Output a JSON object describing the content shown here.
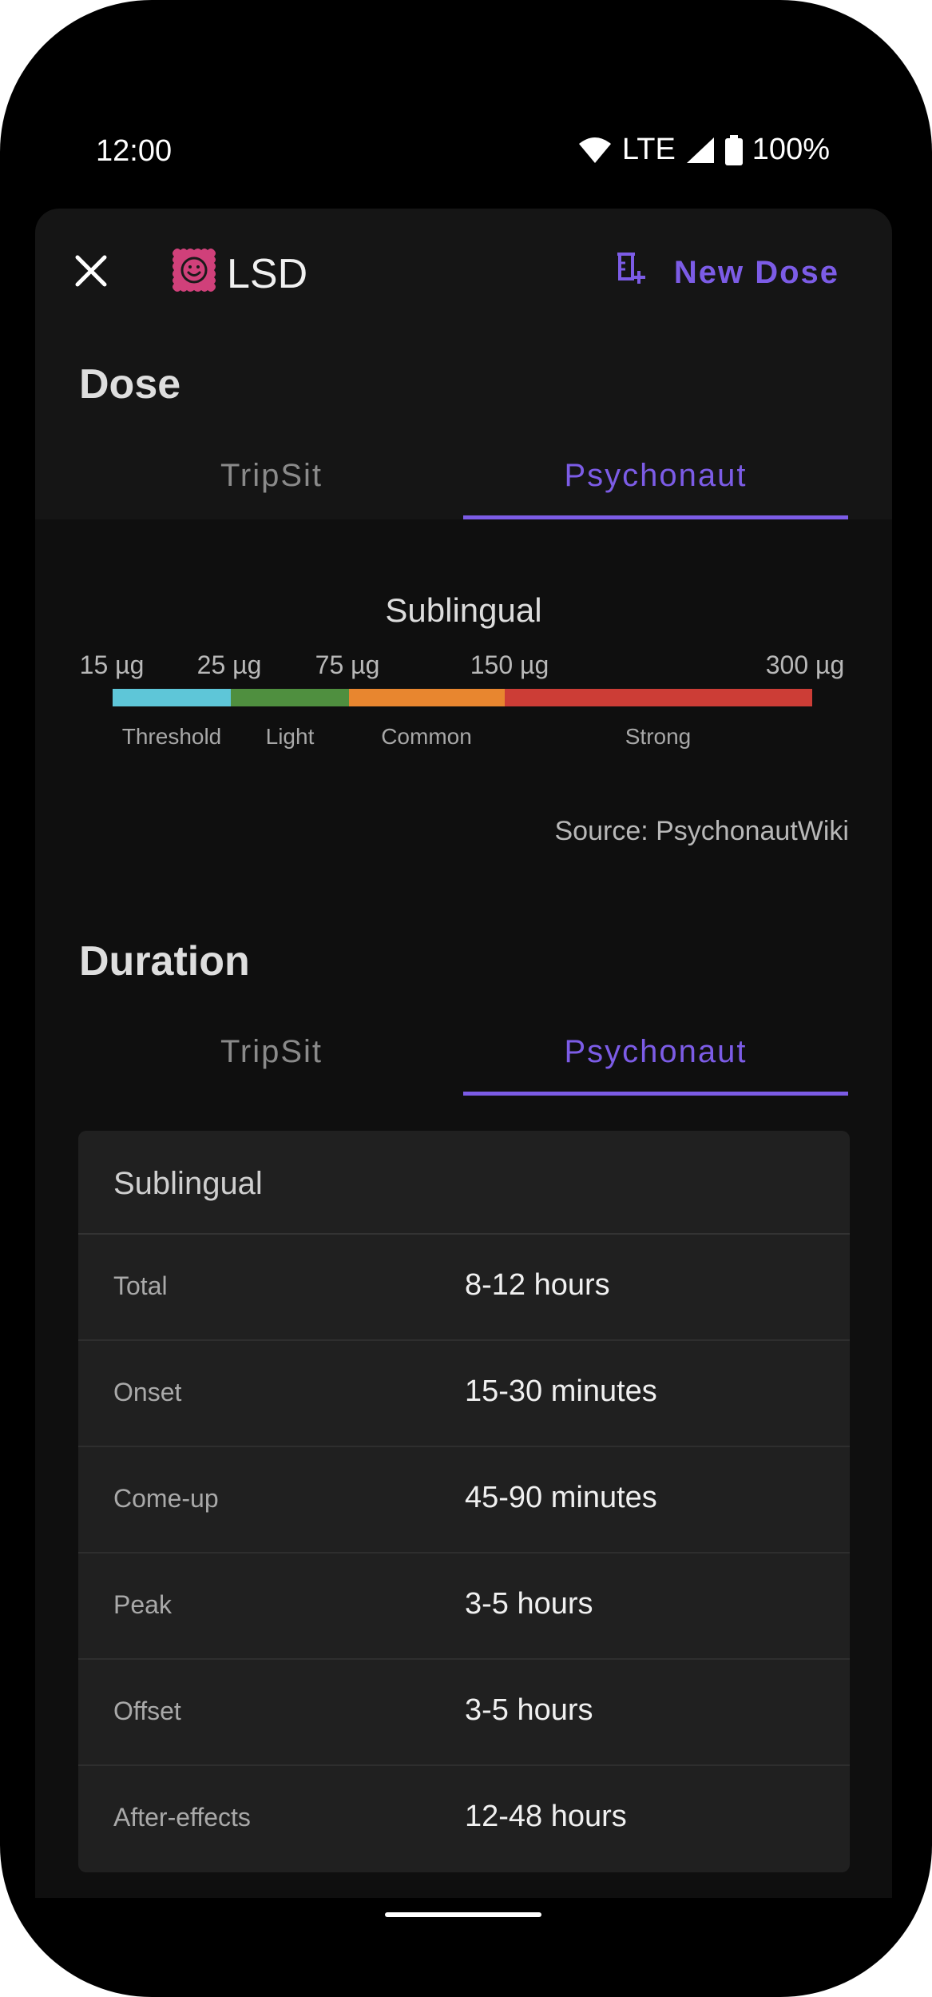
{
  "status_bar": {
    "time": "12:00",
    "network": "LTE",
    "battery": "100%"
  },
  "header": {
    "title": "LSD",
    "new_dose_label": "New Dose",
    "icon_color": "#d0407a"
  },
  "dose": {
    "title": "Dose",
    "tabs": [
      {
        "label": "TripSit",
        "active": false
      },
      {
        "label": "Psychonaut",
        "active": true
      }
    ],
    "route": "Sublingual",
    "ticks": [
      "15 µg",
      "25 µg",
      "75 µg",
      "150 µg",
      "300 µg"
    ],
    "ranges": [
      {
        "label": "Threshold",
        "color": "#5ec6d8"
      },
      {
        "label": "Light",
        "color": "#4f8f3f"
      },
      {
        "label": "Common",
        "color": "#e8862f"
      },
      {
        "label": "Strong",
        "color": "#cc3d36"
      }
    ],
    "source": "Source: PsychonautWiki"
  },
  "duration": {
    "title": "Duration",
    "tabs": [
      {
        "label": "TripSit",
        "active": false
      },
      {
        "label": "Psychonaut",
        "active": true
      }
    ],
    "route": "Sublingual",
    "rows": [
      {
        "key": "Total",
        "value": "8-12 hours"
      },
      {
        "key": "Onset",
        "value": "15-30 minutes"
      },
      {
        "key": "Come-up",
        "value": "45-90 minutes"
      },
      {
        "key": "Peak",
        "value": "3-5 hours"
      },
      {
        "key": "Offset",
        "value": "3-5 hours"
      },
      {
        "key": "After-effects",
        "value": "12-48 hours"
      }
    ]
  },
  "colors": {
    "accent": "#7c5ce6"
  }
}
